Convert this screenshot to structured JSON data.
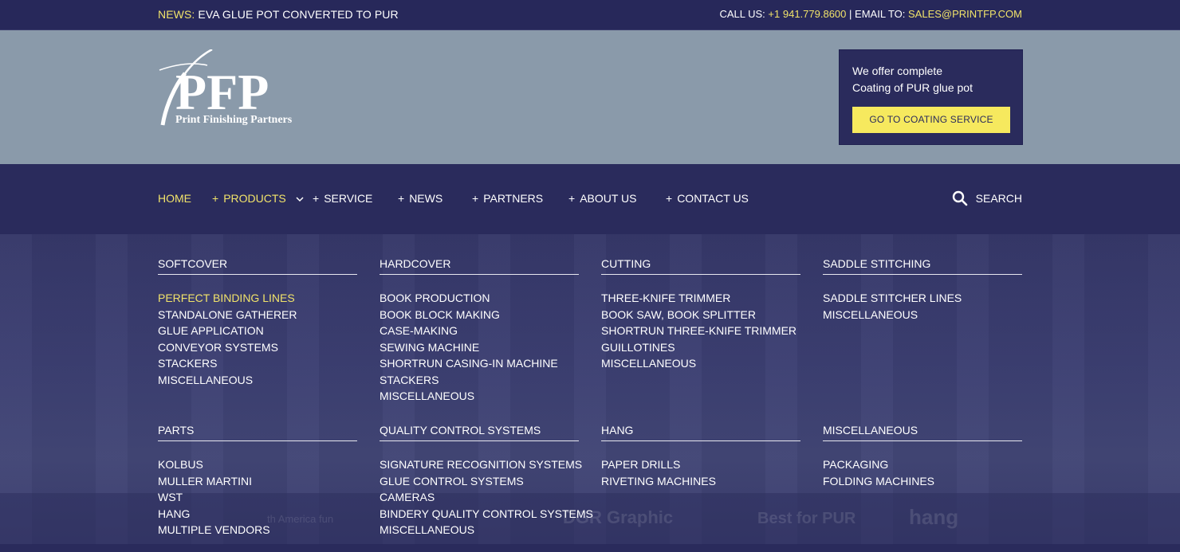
{
  "topbar": {
    "news_label": "NEWS:",
    "news_text": "EVA GLUE POT CONVERTED TO PUR",
    "call_label": "CALL US:",
    "phone": "+1 941.779.8600",
    "separator": "|",
    "email_label": "EMAIL TO:",
    "email": "SALES@PRINTFP.COM"
  },
  "logo": {
    "letters": "PFP",
    "tagline": "Print Finishing Partners"
  },
  "promo": {
    "line1": "We offer complete",
    "line2": "Coating of PUR glue pot",
    "button": "GO TO COATING SERVICE"
  },
  "nav": {
    "home": "HOME",
    "products": "PRODUCTS",
    "service": "SERVICE",
    "news": "NEWS",
    "partners": "PARTNERS",
    "about": "ABOUT US",
    "contact": "CONTACT US",
    "search": "SEARCH",
    "plus": "+"
  },
  "mega": {
    "softcover": {
      "title": "SOFTCOVER",
      "items": [
        "PERFECT BINDING LINES",
        "STANDALONE GATHERER",
        "GLUE APPLICATION",
        "CONVEYOR SYSTEMS",
        "STACKERS",
        "MISCELLANEOUS"
      ]
    },
    "hardcover": {
      "title": "HARDCOVER",
      "items": [
        "BOOK PRODUCTION",
        "BOOK BLOCK MAKING",
        "CASE-MAKING",
        "SEWING MACHINE",
        "SHORTRUN CASING-IN MACHINE",
        "STACKERS",
        "MISCELLANEOUS"
      ]
    },
    "cutting": {
      "title": "CUTTING",
      "items": [
        "THREE-KNIFE TRIMMER",
        "BOOK SAW, BOOK SPLITTER",
        "SHORTRUN THREE-KNIFE TRIMMER",
        "GUILLOTINES",
        "MISCELLANEOUS"
      ]
    },
    "saddle": {
      "title": "SADDLE STITCHING",
      "items": [
        "SADDLE STITCHER LINES",
        "MISCELLANEOUS"
      ]
    },
    "parts": {
      "title": "PARTS",
      "items": [
        "KOLBUS",
        "MULLER MARTINI",
        "WST",
        "HANG",
        "MULTIPLE VENDORS"
      ]
    },
    "quality": {
      "title": "QUALITY CONTROL SYSTEMS",
      "items": [
        "SIGNATURE RECOGNITION SYSTEMS",
        "GLUE CONTROL SYSTEMS",
        "CAMERAS",
        "BINDERY QUALITY CONTROL SYSTEMS",
        "MISCELLANEOUS"
      ]
    },
    "hang": {
      "title": "HANG",
      "items": [
        "PAPER DRILLS",
        "RIVETING MACHINES"
      ]
    },
    "misc": {
      "title": "MISCELLANEOUS",
      "items": [
        "PACKAGING",
        "FOLDING MACHINES"
      ]
    }
  },
  "background_logos": {
    "dgr": "DGR Graphic",
    "best": "Best for PUR",
    "hang": "hang",
    "america": "th America fun"
  },
  "colors": {
    "navy": "#2a2b5c",
    "accent_yellow": "#f1e36a",
    "header_gray": "#8a9aaa"
  }
}
